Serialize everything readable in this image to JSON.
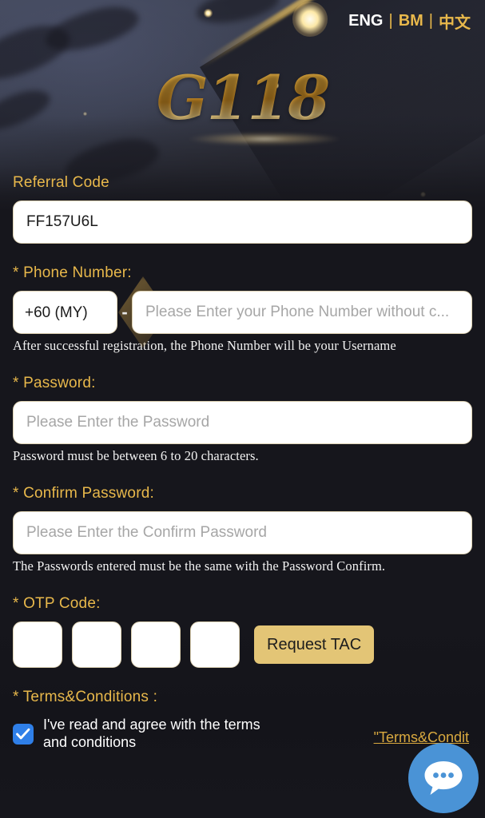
{
  "brand": {
    "logo_text": "G118"
  },
  "language": {
    "options": [
      {
        "label": "ENG",
        "active": true
      },
      {
        "label": "BM",
        "active": false
      },
      {
        "label": "中文",
        "active": false
      }
    ],
    "separator": "|"
  },
  "form": {
    "referral": {
      "label": "Referral Code",
      "value": "FF157U6L",
      "placeholder": ""
    },
    "phone": {
      "label": "* Phone Number:",
      "country_code": "+60 (MY)",
      "separator": "-",
      "placeholder": "Please Enter your Phone Number without c...",
      "value": "",
      "hint": "After successful registration, the Phone Number will be your Username"
    },
    "password": {
      "label": "* Password:",
      "placeholder": "Please Enter the Password",
      "value": "",
      "hint": "Password must be between 6 to 20 characters."
    },
    "confirm_password": {
      "label": "* Confirm Password:",
      "placeholder": "Please Enter the Confirm Password",
      "value": "",
      "hint": "The Passwords entered must be the same with the Password Confirm."
    },
    "otp": {
      "label": "* OTP Code:",
      "digits": [
        "",
        "",
        "",
        ""
      ],
      "request_button": "Request TAC"
    },
    "terms": {
      "label": "* Terms&Conditions :",
      "agree_text": "I've read and agree with the terms and conditions",
      "checked": true,
      "link_text": "\"Terms&Condit"
    }
  },
  "chat": {
    "icon": "chat-bubble-icon"
  },
  "colors": {
    "gold_label": "#e8b84b",
    "gold_button": "#e3c576",
    "gold_link": "#d9a93f",
    "checkbox_blue": "#2f7fe8",
    "chat_blue": "#4a93d6",
    "page_bg": "#16161c",
    "input_bg": "#ffffff"
  }
}
